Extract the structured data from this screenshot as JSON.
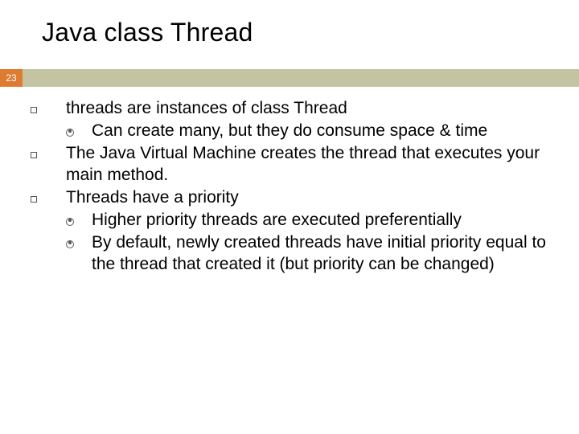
{
  "slide": {
    "title": "Java class Thread",
    "page_number": "23",
    "bullets": [
      {
        "level": 1,
        "text": "threads are instances of class Thread",
        "children": [
          {
            "level": 2,
            "text": "Can create many, but they do consume space & time"
          }
        ]
      },
      {
        "level": 1,
        "text": "The Java Virtual Machine creates the thread that executes your main method."
      },
      {
        "level": 1,
        "text": "Threads have a priority",
        "children": [
          {
            "level": 2,
            "text": "Higher priority threads are executed preferentially"
          },
          {
            "level": 2,
            "text": "By default, newly created threads have initial priority equal to the thread that created it (but priority can be changed)"
          }
        ]
      }
    ]
  }
}
